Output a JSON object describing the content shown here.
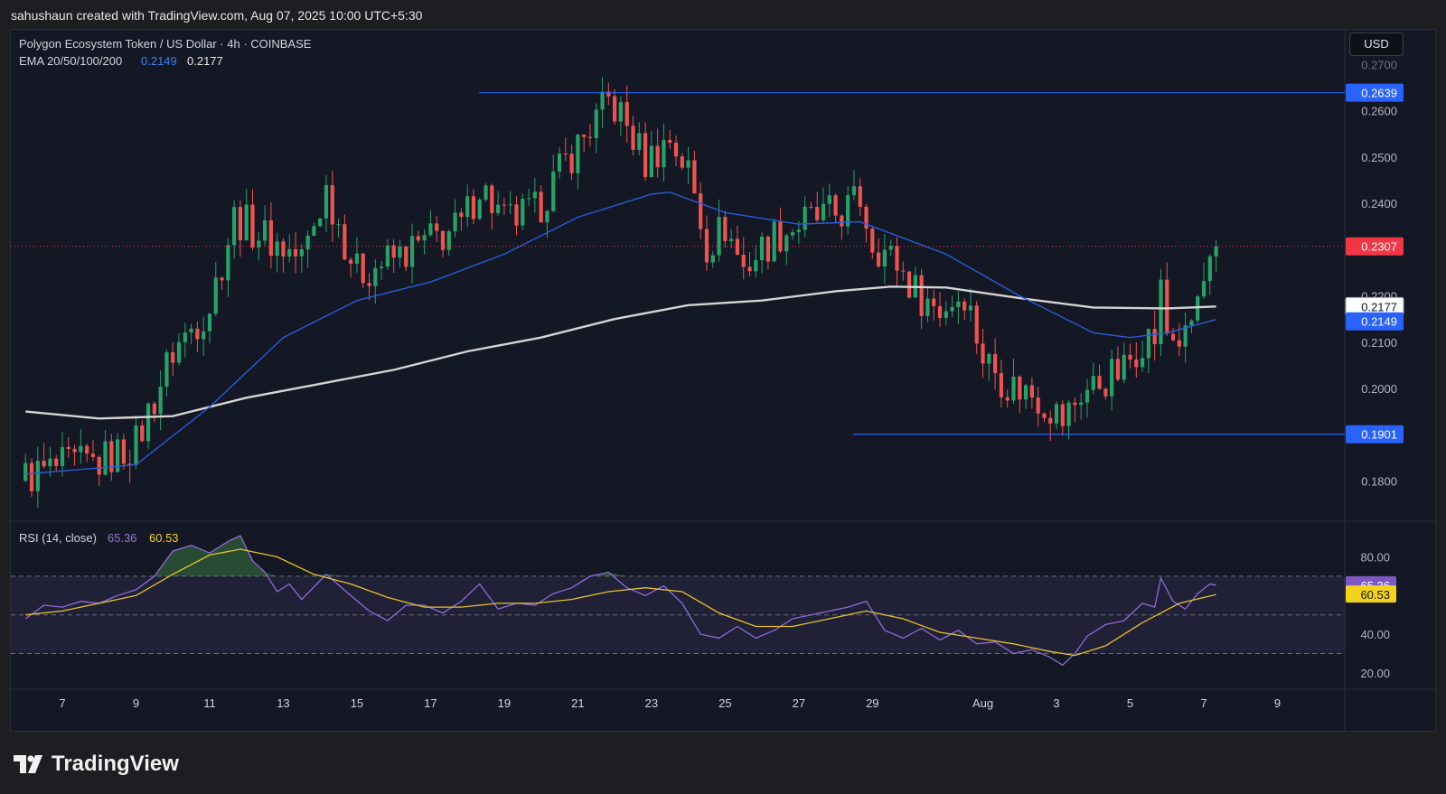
{
  "credit": "sahushaun created with TradingView.com, Aug 07, 2025 10:00 UTC+5:30",
  "currency_button": "USD",
  "brand": "TradingView",
  "colors": {
    "up": "#26a269",
    "down": "#ef5350",
    "ema50": "#2a5bd7",
    "ema200": "#d4d4d4",
    "rsi": "#8e6bd6",
    "rsi_ma": "#e6c229",
    "level": "#2962ff",
    "last_price": "#f23645"
  },
  "chart_data": [
    {
      "type": "candlestick",
      "title": "Polygon Ecosystem Token / US Dollar · 4h · COINBASE",
      "indicator_label": "EMA 20/50/100/200",
      "indicator_values": [
        "0.2149",
        "0.2177"
      ],
      "x_ticks": [
        "7",
        "9",
        "11",
        "13",
        "15",
        "17",
        "19",
        "21",
        "23",
        "25",
        "27",
        "29",
        "Aug",
        "3",
        "5",
        "7",
        "9"
      ],
      "y_ticks": [
        "0.1800",
        "0.2000",
        "0.2100",
        "0.2200",
        "0.2400",
        "0.2500",
        "0.2600"
      ],
      "ylim": [
        0.1715,
        0.2775
      ],
      "price_labels": {
        "resistance": "0.2639",
        "last": "0.2307",
        "ema200": "0.2177",
        "ema50": "0.2149",
        "support": "0.1901"
      },
      "levels": {
        "resistance": 0.2639,
        "support": 0.1901,
        "last": 0.2307
      },
      "key_points": [
        [
          "Jul 6 00:00",
          0.181
        ],
        [
          "Jul 7 00:00",
          0.183
        ],
        [
          "Jul 8 00:00",
          0.184
        ],
        [
          "Jul 9 00:00",
          0.188
        ],
        [
          "Jul 10 00:00",
          0.208
        ],
        [
          "Jul 11 00:00",
          0.218
        ],
        [
          "Jul 11 16:00",
          0.237
        ],
        [
          "Jul 12 16:00",
          0.232
        ],
        [
          "Jul 13 12:00",
          0.228
        ],
        [
          "Jul 14 04:00",
          0.243
        ],
        [
          "Jul 15 00:00",
          0.225
        ],
        [
          "Jul 16 00:00",
          0.228
        ],
        [
          "Jul 17 00:00",
          0.232
        ],
        [
          "Jul 17 20:00",
          0.235
        ],
        [
          "Jul 18 08:00",
          0.244
        ],
        [
          "Jul 19 00:00",
          0.236
        ],
        [
          "Jul 19 20:00",
          0.238
        ],
        [
          "Jul 20 16:00",
          0.249
        ],
        [
          "Jul 21 12:00",
          0.258
        ],
        [
          "Jul 21 20:00",
          0.262
        ],
        [
          "Jul 22 04:00",
          0.259
        ],
        [
          "Jul 22 20:00",
          0.249
        ],
        [
          "Jul 23 12:00",
          0.254
        ],
        [
          "Jul 24 00:00",
          0.247
        ],
        [
          "Jul 24 12:00",
          0.231
        ],
        [
          "Jul 25 00:00",
          0.235
        ],
        [
          "Jul 25 12:00",
          0.226
        ],
        [
          "Jul 26 08:00",
          0.233
        ],
        [
          "Jul 27 04:00",
          0.236
        ],
        [
          "Jul 28 04:00",
          0.238
        ],
        [
          "Jul 28 16:00",
          0.241
        ],
        [
          "Jul 29 00:00",
          0.232
        ],
        [
          "Jul 29 16:00",
          0.227
        ],
        [
          "Jul 30 04:00",
          0.221
        ],
        [
          "Jul 30 20:00",
          0.217
        ],
        [
          "Jul 31 12:00",
          0.221
        ],
        [
          "Aug 1 00:00",
          0.207
        ],
        [
          "Aug 1 16:00",
          0.201
        ],
        [
          "Aug 2 08:00",
          0.199
        ],
        [
          "Aug 2 20:00",
          0.196
        ],
        [
          "Aug 3 04:00",
          0.193
        ],
        [
          "Aug 3 16:00",
          0.199
        ],
        [
          "Aug 4 08:00",
          0.202
        ],
        [
          "Aug 4 20:00",
          0.204
        ],
        [
          "Aug 5 08:00",
          0.211
        ],
        [
          "Aug 5 16:00",
          0.211
        ],
        [
          "Aug 5 20:00",
          0.221
        ],
        [
          "Aug 6 00:00",
          0.212
        ],
        [
          "Aug 6 12:00",
          0.21
        ],
        [
          "Aug 6 20:00",
          0.219
        ],
        [
          "Aug 7 04:00",
          0.226
        ],
        [
          "Aug 7 08:00",
          0.2307
        ]
      ],
      "ema50": [
        [
          "Jul 6 00:00",
          0.1815
        ],
        [
          "Jul 9 00:00",
          0.1835
        ],
        [
          "Jul 11 00:00",
          0.196
        ],
        [
          "Jul 13 00:00",
          0.211
        ],
        [
          "Jul 15 00:00",
          0.219
        ],
        [
          "Jul 17 00:00",
          0.223
        ],
        [
          "Jul 19 00:00",
          0.229
        ],
        [
          "Jul 21 00:00",
          0.237
        ],
        [
          "Jul 23 00:00",
          0.242
        ],
        [
          "Jul 23 12:00",
          0.2424
        ],
        [
          "Jul 25 00:00",
          0.238
        ],
        [
          "Jul 27 00:00",
          0.2355
        ],
        [
          "Jul 28 16:00",
          0.236
        ],
        [
          "Jul 29 00:00",
          0.235
        ],
        [
          "Jul 31 00:00",
          0.229
        ],
        [
          "Aug 2 00:00",
          0.22
        ],
        [
          "Aug 4 00:00",
          0.212
        ],
        [
          "Aug 5 00:00",
          0.211
        ],
        [
          "Aug 6 00:00",
          0.212
        ],
        [
          "Aug 7 08:00",
          0.2149
        ]
      ],
      "ema200": [
        [
          "Jul 6 00:00",
          0.195
        ],
        [
          "Jul 8 00:00",
          0.1935
        ],
        [
          "Jul 10 00:00",
          0.194
        ],
        [
          "Jul 12 00:00",
          0.198
        ],
        [
          "Jul 14 00:00",
          0.201
        ],
        [
          "Jul 16 00:00",
          0.204
        ],
        [
          "Jul 18 00:00",
          0.208
        ],
        [
          "Jul 20 00:00",
          0.211
        ],
        [
          "Jul 22 00:00",
          0.215
        ],
        [
          "Jul 24 00:00",
          0.218
        ],
        [
          "Jul 26 00:00",
          0.219
        ],
        [
          "Jul 28 00:00",
          0.221
        ],
        [
          "Jul 29 12:00",
          0.222
        ],
        [
          "Jul 31 00:00",
          0.2218
        ],
        [
          "Aug 2 00:00",
          0.2195
        ],
        [
          "Aug 4 00:00",
          0.2175
        ],
        [
          "Aug 6 00:00",
          0.2173
        ],
        [
          "Aug 7 08:00",
          0.2177
        ]
      ]
    },
    {
      "type": "line",
      "title": "RSI (14, close)",
      "values_label": [
        "65.36",
        "60.53"
      ],
      "y_ticks": [
        "20.00",
        "40.00",
        "80.00"
      ],
      "ylim": [
        12,
        98
      ],
      "bands": [
        30,
        50,
        70
      ],
      "series": [
        {
          "name": "RSI",
          "points": [
            [
              "Jul 6 00:00",
              48
            ],
            [
              "Jul 6 12:00",
              55
            ],
            [
              "Jul 7 00:00",
              54
            ],
            [
              "Jul 7 12:00",
              57
            ],
            [
              "Jul 8 00:00",
              56
            ],
            [
              "Jul 8 12:00",
              60
            ],
            [
              "Jul 9 00:00",
              63
            ],
            [
              "Jul 9 12:00",
              70
            ],
            [
              "Jul 10 00:00",
              83
            ],
            [
              "Jul 10 12:00",
              86
            ],
            [
              "Jul 11 00:00",
              82
            ],
            [
              "Jul 11 12:00",
              88
            ],
            [
              "Jul 11 20:00",
              91
            ],
            [
              "Jul 12 04:00",
              78
            ],
            [
              "Jul 12 12:00",
              72
            ],
            [
              "Jul 12 20:00",
              62
            ],
            [
              "Jul 13 04:00",
              66
            ],
            [
              "Jul 13 12:00",
              58
            ],
            [
              "Jul 14 04:00",
              71
            ],
            [
              "Jul 14 20:00",
              60
            ],
            [
              "Jul 15 08:00",
              52
            ],
            [
              "Jul 15 20:00",
              47
            ],
            [
              "Jul 16 08:00",
              55
            ],
            [
              "Jul 16 20:00",
              55
            ],
            [
              "Jul 17 08:00",
              51
            ],
            [
              "Jul 17 20:00",
              57
            ],
            [
              "Jul 18 08:00",
              66
            ],
            [
              "Jul 18 20:00",
              53
            ],
            [
              "Jul 19 08:00",
              56
            ],
            [
              "Jul 19 20:00",
              55
            ],
            [
              "Jul 20 08:00",
              61
            ],
            [
              "Jul 20 20:00",
              64
            ],
            [
              "Jul 21 08:00",
              70
            ],
            [
              "Jul 21 20:00",
              72
            ],
            [
              "Jul 22 08:00",
              64
            ],
            [
              "Jul 22 20:00",
              60
            ],
            [
              "Jul 23 08:00",
              65
            ],
            [
              "Jul 23 20:00",
              56
            ],
            [
              "Jul 24 08:00",
              40
            ],
            [
              "Jul 24 20:00",
              38
            ],
            [
              "Jul 25 08:00",
              44
            ],
            [
              "Jul 25 20:00",
              38
            ],
            [
              "Jul 26 08:00",
              42
            ],
            [
              "Jul 26 20:00",
              48
            ],
            [
              "Jul 27 08:00",
              50
            ],
            [
              "Jul 27 20:00",
              52
            ],
            [
              "Jul 28 08:00",
              54
            ],
            [
              "Jul 28 20:00",
              57
            ],
            [
              "Jul 29 08:00",
              42
            ],
            [
              "Jul 29 20:00",
              38
            ],
            [
              "Jul 30 08:00",
              43
            ],
            [
              "Jul 30 20:00",
              37
            ],
            [
              "Jul 31 08:00",
              42
            ],
            [
              "Jul 31 20:00",
              35
            ],
            [
              "Aug 1 08:00",
              36
            ],
            [
              "Aug 1 20:00",
              30
            ],
            [
              "Aug 2 08:00",
              32
            ],
            [
              "Aug 2 20:00",
              28
            ],
            [
              "Aug 3 04:00",
              24
            ],
            [
              "Aug 3 12:00",
              30
            ],
            [
              "Aug 3 20:00",
              39
            ],
            [
              "Aug 4 08:00",
              45
            ],
            [
              "Aug 4 20:00",
              47
            ],
            [
              "Aug 5 08:00",
              56
            ],
            [
              "Aug 5 16:00",
              54
            ],
            [
              "Aug 5 20:00",
              69
            ],
            [
              "Aug 6 04:00",
              57
            ],
            [
              "Aug 6 12:00",
              53
            ],
            [
              "Aug 6 20:00",
              61
            ],
            [
              "Aug 7 04:00",
              66
            ],
            [
              "Aug 7 08:00",
              65.36
            ]
          ]
        },
        {
          "name": "RSI-based MA",
          "points": [
            [
              "Jul 6 00:00",
              50
            ],
            [
              "Jul 7 00:00",
              52
            ],
            [
              "Jul 8 00:00",
              56
            ],
            [
              "Jul 9 00:00",
              60
            ],
            [
              "Jul 10 00:00",
              71
            ],
            [
              "Jul 11 00:00",
              81
            ],
            [
              "Jul 11 20:00",
              84
            ],
            [
              "Jul 12 20:00",
              80
            ],
            [
              "Jul 13 20:00",
              71
            ],
            [
              "Jul 14 20:00",
              66
            ],
            [
              "Jul 15 20:00",
              59
            ],
            [
              "Jul 16 20:00",
              54
            ],
            [
              "Jul 17 20:00",
              54
            ],
            [
              "Jul 18 20:00",
              56
            ],
            [
              "Jul 19 20:00",
              56
            ],
            [
              "Jul 20 20:00",
              58
            ],
            [
              "Jul 21 20:00",
              62
            ],
            [
              "Jul 22 20:00",
              64
            ],
            [
              "Jul 23 20:00",
              62
            ],
            [
              "Jul 24 20:00",
              51
            ],
            [
              "Jul 25 20:00",
              44
            ],
            [
              "Jul 26 20:00",
              44
            ],
            [
              "Jul 27 20:00",
              48
            ],
            [
              "Jul 28 20:00",
              52
            ],
            [
              "Jul 29 20:00",
              48
            ],
            [
              "Jul 30 20:00",
              41
            ],
            [
              "Jul 31 20:00",
              38
            ],
            [
              "Aug 1 20:00",
              35
            ],
            [
              "Aug 2 20:00",
              31
            ],
            [
              "Aug 3 12:00",
              29
            ],
            [
              "Aug 4 08:00",
              34
            ],
            [
              "Aug 5 08:00",
              46
            ],
            [
              "Aug 6 08:00",
              56
            ],
            [
              "Aug 7 08:00",
              60.53
            ]
          ]
        }
      ]
    }
  ]
}
